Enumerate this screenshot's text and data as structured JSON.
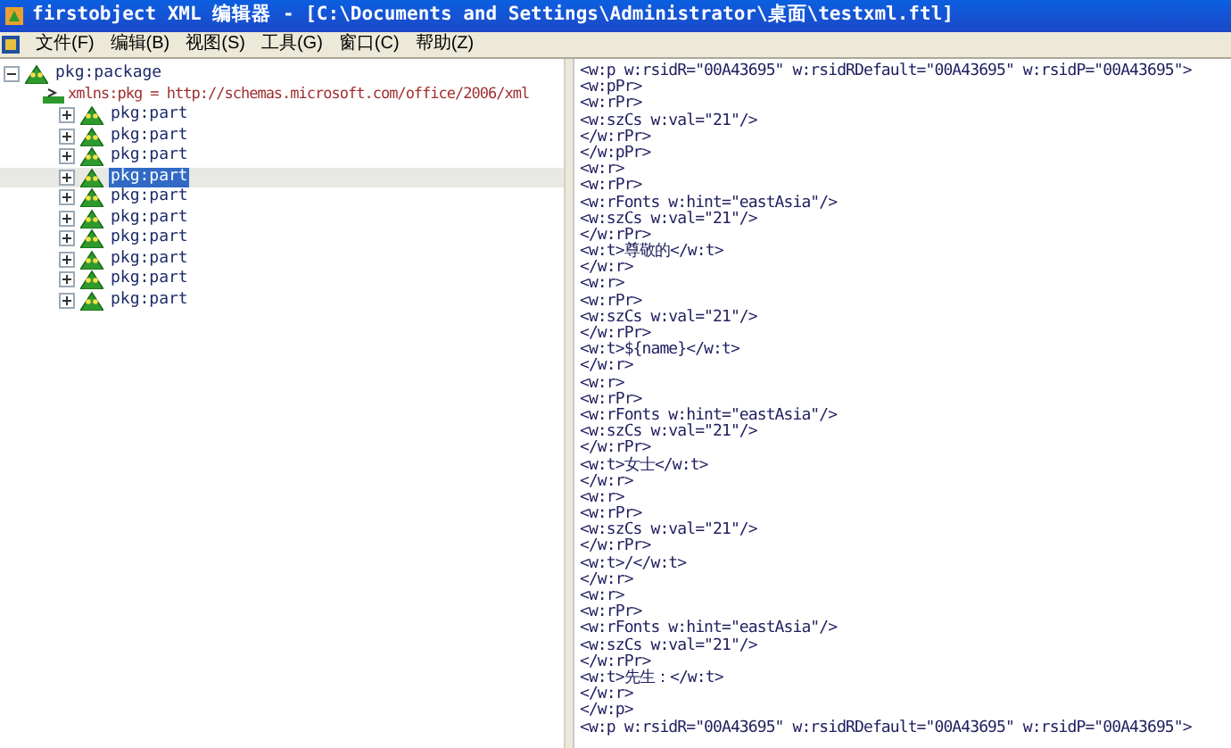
{
  "window": {
    "title": "firstobject XML 编辑器 - [C:\\Documents and Settings\\Administrator\\桌面\\testxml.ftl]"
  },
  "menu": [
    "文件(F)",
    "编辑(B)",
    "视图(S)",
    "工具(G)",
    "窗口(C)",
    "帮助(Z)"
  ],
  "tree": [
    {
      "kind": "element",
      "label": "pkg:package",
      "expanded": true,
      "selected": false,
      "children": [
        {
          "kind": "attribute",
          "label": "xmlns:pkg = http://schemas.microsoft.com/office/2006/xml"
        },
        {
          "kind": "element",
          "label": "pkg:part",
          "expanded": false,
          "selected": false
        },
        {
          "kind": "element",
          "label": "pkg:part",
          "expanded": false,
          "selected": false
        },
        {
          "kind": "element",
          "label": "pkg:part",
          "expanded": false,
          "selected": false
        },
        {
          "kind": "element",
          "label": "pkg:part",
          "expanded": false,
          "selected": true
        },
        {
          "kind": "element",
          "label": "pkg:part",
          "expanded": false,
          "selected": false
        },
        {
          "kind": "element",
          "label": "pkg:part",
          "expanded": false,
          "selected": false
        },
        {
          "kind": "element",
          "label": "pkg:part",
          "expanded": false,
          "selected": false
        },
        {
          "kind": "element",
          "label": "pkg:part",
          "expanded": false,
          "selected": false
        },
        {
          "kind": "element",
          "label": "pkg:part",
          "expanded": false,
          "selected": false
        },
        {
          "kind": "element",
          "label": "pkg:part",
          "expanded": false,
          "selected": false
        }
      ]
    }
  ],
  "editor_lines": [
    "<w:p w:rsidR=\"00A43695\" w:rsidRDefault=\"00A43695\" w:rsidP=\"00A43695\">",
    "<w:pPr>",
    "<w:rPr>",
    "<w:szCs w:val=\"21\"/>",
    "</w:rPr>",
    "</w:pPr>",
    "<w:r>",
    "<w:rPr>",
    "<w:rFonts w:hint=\"eastAsia\"/>",
    "<w:szCs w:val=\"21\"/>",
    "</w:rPr>",
    "<w:t>尊敬的</w:t>",
    "</w:r>",
    "<w:r>",
    "<w:rPr>",
    "<w:szCs w:val=\"21\"/>",
    "</w:rPr>",
    "<w:t>${name}</w:t>",
    "</w:r>",
    "<w:r>",
    "<w:rPr>",
    "<w:rFonts w:hint=\"eastAsia\"/>",
    "<w:szCs w:val=\"21\"/>",
    "</w:rPr>",
    "<w:t>女士</w:t>",
    "</w:r>",
    "<w:r>",
    "<w:rPr>",
    "<w:szCs w:val=\"21\"/>",
    "</w:rPr>",
    "<w:t>/</w:t>",
    "</w:r>",
    "<w:r>",
    "<w:rPr>",
    "<w:rFonts w:hint=\"eastAsia\"/>",
    "<w:szCs w:val=\"21\"/>",
    "</w:rPr>",
    "<w:t>先生：</w:t>",
    "</w:r>",
    "</w:p>",
    "<w:p w:rsidR=\"00A43695\" w:rsidRDefault=\"00A43695\" w:rsidP=\"00A43695\">"
  ]
}
